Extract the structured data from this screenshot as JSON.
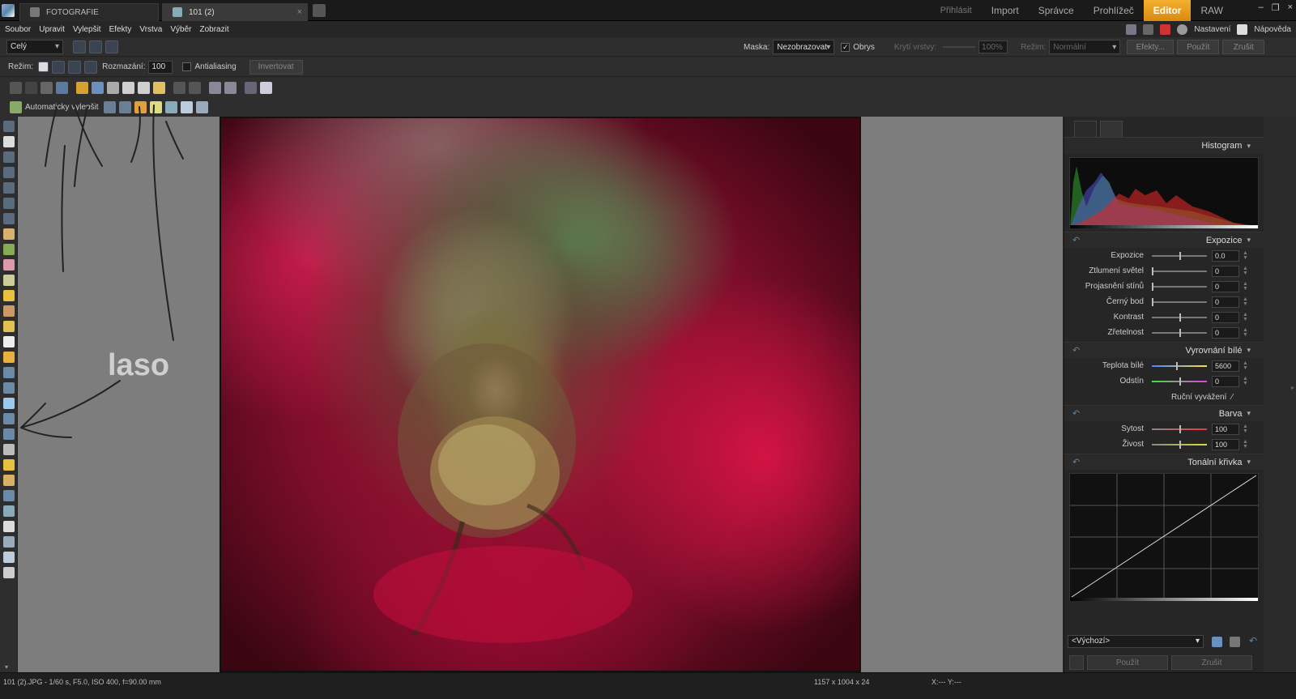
{
  "tabs": {
    "library": "FOTOGRAFIE",
    "active": "101 (2)",
    "close": "×"
  },
  "modes": {
    "login": "Přihlásit",
    "import": "Import",
    "manager": "Správce",
    "viewer": "Prohlížeč",
    "editor": "Editor",
    "raw": "RAW"
  },
  "window_buttons": {
    "minimize": "–",
    "restore": "❐",
    "close": "×"
  },
  "menu": [
    "Soubor",
    "Upravit",
    "Vylepšit",
    "Efekty",
    "Vrstva",
    "Výběr",
    "Zobrazit"
  ],
  "menu_right": {
    "settings": "Nastavení",
    "help": "Nápověda"
  },
  "options": {
    "scope": "Celý",
    "mask_label": "Maska:",
    "mask_value": "Nezobrazovat",
    "outline_label": "Obrys",
    "outline_checked": "✓",
    "opacity_label": "Krytí vrstvy:",
    "opacity_value": "100%",
    "blend_label": "Režim:",
    "blend_value": "Normální",
    "effects_btn": "Efekty...",
    "apply_btn": "Použít",
    "cancel_btn": "Zrušit"
  },
  "options2": {
    "mode_label": "Režim:",
    "feather_label": "Rozmazání:",
    "feather_value": "100",
    "antialias_label": "Antialiasing",
    "invert_btn": "Invertovat"
  },
  "toolbar4": {
    "auto_enhance": "Automaticky vylepšit"
  },
  "annotation": {
    "text": "laso"
  },
  "panel": {
    "histogram": "Histogram",
    "exposure": {
      "title": "Expozice",
      "rows": [
        {
          "label": "Expozice",
          "value": "0.0"
        },
        {
          "label": "Ztlumení světel",
          "value": "0"
        },
        {
          "label": "Projasnění stínů",
          "value": "0"
        },
        {
          "label": "Černý bod",
          "value": "0"
        },
        {
          "label": "Kontrast",
          "value": "0"
        },
        {
          "label": "Zřetelnost",
          "value": "0"
        }
      ]
    },
    "whitebalance": {
      "title": "Vyrovnání bílé",
      "rows": [
        {
          "label": "Teplota bílé",
          "value": "5600"
        },
        {
          "label": "Odstín",
          "value": "0"
        }
      ],
      "manual": "Ruční vyvážení"
    },
    "color": {
      "title": "Barva",
      "rows": [
        {
          "label": "Sytost",
          "value": "100"
        },
        {
          "label": "Živost",
          "value": "100"
        }
      ]
    },
    "curve": {
      "title": "Tonální křivka"
    },
    "preset": "<Výchozí>",
    "apply": "Použít",
    "cancel": "Zrušit"
  },
  "status": {
    "file": "101 (2).JPG - 1/60 s, F5.0, ISO 400, f=90.00 mm",
    "dims": "1157 x 1004 x 24",
    "coords": "X:---  Y:---"
  },
  "colors": {
    "accent": "#f0a020",
    "canvas_bg": "#7d7d7d",
    "panel_bg": "#262626"
  }
}
